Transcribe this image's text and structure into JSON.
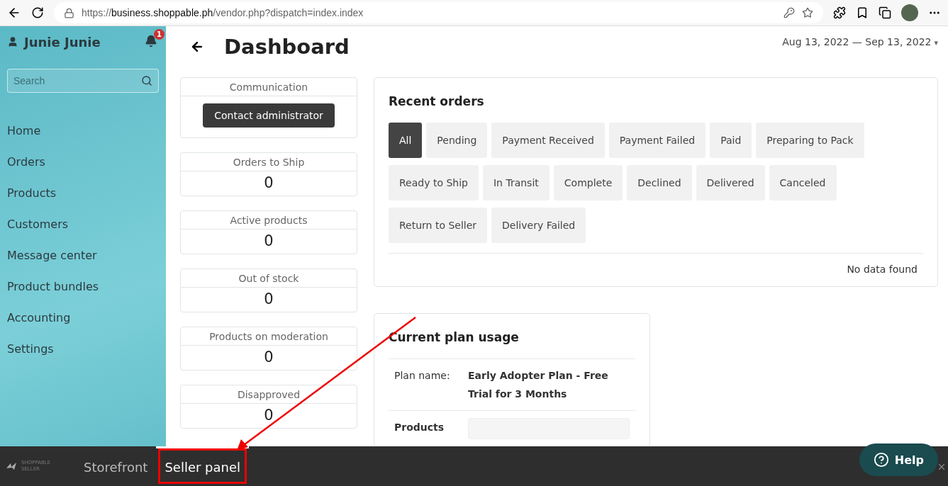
{
  "browser": {
    "url_scheme": "https://",
    "url_host": "business.shoppable.ph",
    "url_path": "/vendor.php?dispatch=index.index"
  },
  "sidebar": {
    "user_name": "Junie Junie",
    "notification_count": "1",
    "search": {
      "placeholder": "Search"
    },
    "items": [
      "Home",
      "Orders",
      "Products",
      "Customers",
      "Message center",
      "Product bundles",
      "Accounting",
      "Settings"
    ]
  },
  "header": {
    "title": "Dashboard",
    "date_range": "Aug 13, 2022 — Sep 13, 2022",
    "caret": "▾"
  },
  "stat_cards": [
    {
      "kind": "action",
      "label": "Communication",
      "button": "Contact administrator"
    },
    {
      "kind": "count",
      "label": "Orders to Ship",
      "value": "0"
    },
    {
      "kind": "count",
      "label": "Active products",
      "value": "0"
    },
    {
      "kind": "count",
      "label": "Out of stock",
      "value": "0"
    },
    {
      "kind": "count",
      "label": "Products on moderation",
      "value": "0"
    },
    {
      "kind": "count",
      "label": "Disapproved",
      "value": "0"
    }
  ],
  "recent_orders": {
    "title": "Recent orders",
    "filters": [
      {
        "label": "All",
        "selected": true
      },
      {
        "label": "Pending",
        "selected": false
      },
      {
        "label": "Payment Received",
        "selected": false
      },
      {
        "label": "Payment Failed",
        "selected": false
      },
      {
        "label": "Paid",
        "selected": false
      },
      {
        "label": "Preparing to Pack",
        "selected": false
      },
      {
        "label": "Ready to Ship",
        "selected": false
      },
      {
        "label": "In Transit",
        "selected": false
      },
      {
        "label": "Complete",
        "selected": false
      },
      {
        "label": "Declined",
        "selected": false
      },
      {
        "label": "Delivered",
        "selected": false
      },
      {
        "label": "Canceled",
        "selected": false
      },
      {
        "label": "Return to Seller",
        "selected": false
      },
      {
        "label": "Delivery Failed",
        "selected": false
      }
    ],
    "empty_message": "No data found"
  },
  "plan_usage": {
    "title": "Current plan usage",
    "plan_label": "Plan name:",
    "plan_name": "Early Adopter Plan - Free Trial for 3 Months",
    "meters": [
      {
        "label": "Products"
      }
    ]
  },
  "bottom_bar": {
    "brand": [
      "SHOPPABLE",
      "SELLER"
    ],
    "tabs": [
      {
        "label": "Storefront",
        "selected": false
      },
      {
        "label": "Seller panel",
        "selected": true
      }
    ],
    "help": "Help"
  }
}
